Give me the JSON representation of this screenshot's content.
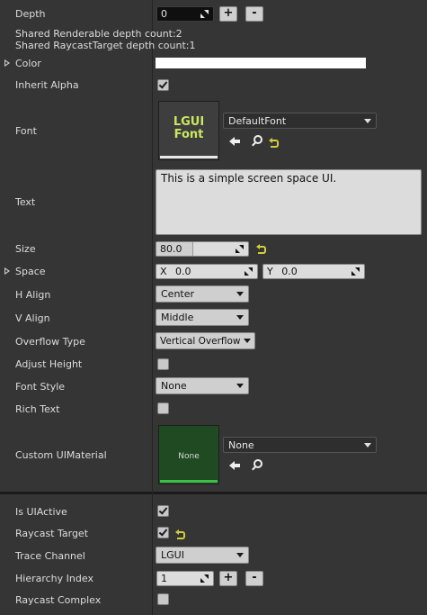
{
  "depth": {
    "label": "Depth",
    "value": "0",
    "plus": "+",
    "minus": "-"
  },
  "info": {
    "renderable": "Shared Renderable depth count:2",
    "raycast": "Shared RaycastTarget depth count:1"
  },
  "color": {
    "label": "Color",
    "value": "#ffffff"
  },
  "inherit_alpha": {
    "label": "Inherit Alpha",
    "checked": true
  },
  "font": {
    "label": "Font",
    "thumb_line1": "LGUI",
    "thumb_line2": "Font",
    "selected": "DefaultFont"
  },
  "text": {
    "label": "Text",
    "value": "This is a simple screen space UI."
  },
  "size": {
    "label": "Size",
    "value": "80.0",
    "slider_fraction": 0.4
  },
  "space": {
    "label": "Space",
    "x_label": "X",
    "x_value": "0.0",
    "y_label": "Y",
    "y_value": "0.0"
  },
  "h_align": {
    "label": "H Align",
    "value": "Center"
  },
  "v_align": {
    "label": "V Align",
    "value": "Middle"
  },
  "overflow": {
    "label": "Overflow Type",
    "value": "Vertical Overflow"
  },
  "adjust_height": {
    "label": "Adjust Height",
    "checked": false
  },
  "font_style": {
    "label": "Font Style",
    "value": "None"
  },
  "rich_text": {
    "label": "Rich Text",
    "checked": false
  },
  "custom_material": {
    "label": "Custom UIMaterial",
    "thumb_text": "None",
    "selected": "None"
  },
  "is_ui_active": {
    "label": "Is UIActive",
    "checked": true
  },
  "raycast_target": {
    "label": "Raycast Target",
    "checked": true
  },
  "trace_channel": {
    "label": "Trace Channel",
    "value": "LGUI"
  },
  "hierarchy_index": {
    "label": "Hierarchy Index",
    "value": "1",
    "plus": "+",
    "minus": "-"
  },
  "raycast_complex": {
    "label": "Raycast Complex",
    "checked": false
  },
  "colors": {
    "panel": "#353535",
    "thumb_font_text": "#c9e85d",
    "material_thumb": "#1f4a22",
    "reset_arrow": "#d4cc3a"
  }
}
